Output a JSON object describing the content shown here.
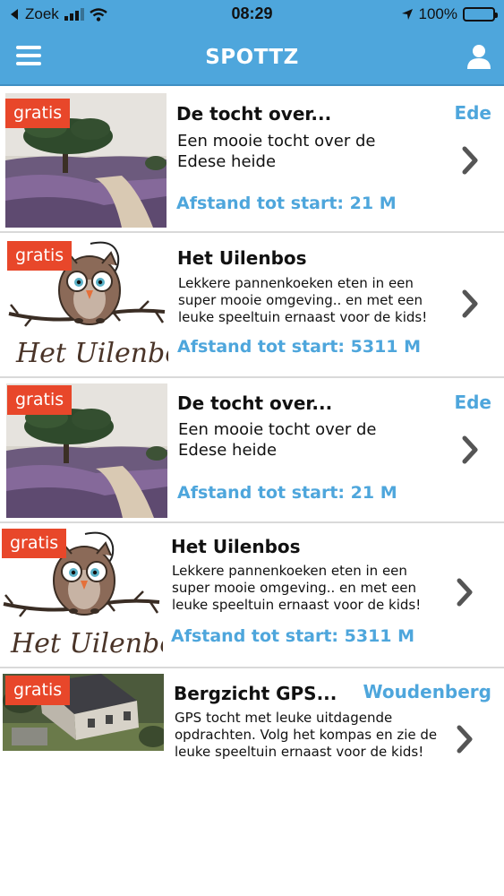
{
  "status_bar": {
    "carrier": "Zoek",
    "time": "08:29",
    "battery": "100%"
  },
  "nav": {
    "title": "SPOTTZ",
    "menu_icon": "hamburger-icon",
    "user_icon": "user-icon"
  },
  "colors": {
    "accent": "#4ea6dc",
    "badge": "#e8472a"
  },
  "items": [
    {
      "badge": "gratis",
      "title": "De tocht over...",
      "location": "Ede",
      "description": [
        "Een mooie tocht over de",
        "Edese heide"
      ],
      "distance": "Afstand tot start: 21 M",
      "image": "heath-photo"
    },
    {
      "badge": "gratis",
      "title": "Het Uilenbos",
      "location": "",
      "description": [
        "Lekkere pannenkoeken eten in een",
        "super mooie omgeving.. en met een",
        "leuke speeltuin ernaast voor de kids!"
      ],
      "distance": "Afstand tot start: 5311 M",
      "image": "owl-logo",
      "logo_text": "Het Uilenbos"
    },
    {
      "badge": "gratis",
      "title": "De tocht over...",
      "location": "Ede",
      "description": [
        "Een mooie tocht over de",
        "Edese heide"
      ],
      "distance": "Afstand tot start: 21 M",
      "image": "heath-photo"
    },
    {
      "badge": "gratis",
      "title": "Het Uilenbos",
      "location": "",
      "description": [
        "Lekkere pannenkoeken eten in een",
        "super mooie omgeving.. en met een",
        "leuke speeltuin ernaast voor de kids!"
      ],
      "distance": "Afstand tot start: 5311 M",
      "image": "owl-logo",
      "logo_text": "Het Uilenbos"
    },
    {
      "badge": "gratis",
      "title": "Bergzicht GPS...",
      "location": "Woudenberg",
      "description": [
        "GPS tocht met leuke uitdagende",
        "opdrachten. Volg het kompas en zie de",
        "leuke speeltuin ernaast voor de kids!"
      ],
      "distance": "",
      "image": "aerial-photo"
    }
  ]
}
